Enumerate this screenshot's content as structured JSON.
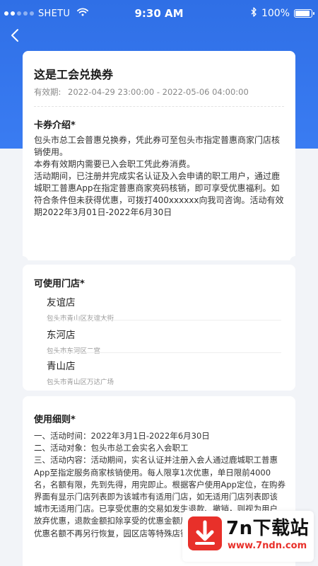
{
  "status_bar": {
    "carrier": "SHETU",
    "time": "9:30 AM",
    "battery": "100%",
    "battery_level": 1.0
  },
  "nav": {
    "back_icon": "chevron-left-icon"
  },
  "coupon": {
    "title": "这是工会兑换券",
    "validity_label": "有效期:",
    "validity_value": "2022-04-29 23:00:00 - 2022-05-06 04:00:00",
    "intro_title": "卡券介绍*",
    "intro_paragraphs": [
      "包头市总工会普惠兑换券，凭此券可至包头市指定普惠商家门店核销使用。",
      "本券有效期内需要已入会职工凭此券消费。",
      "活动期间，已注册并完成实名认证及入会申请的职工用户，通过鹿城职工普惠App在指定普惠商家亮码核销，即可享受优惠福利。如符合条件但未获得优惠，可拨打400xxxxxx向我司咨询。活动有效期2022年3月01日-2022年6月30日"
    ]
  },
  "stores": {
    "title": "可使用门店*",
    "items": [
      {
        "name": "友谊店",
        "address": "包头市青山区友谊大街"
      },
      {
        "name": "东河店",
        "address": "包头市东河区二宫"
      },
      {
        "name": "青山店",
        "address": "包头市青山区万达广场"
      }
    ]
  },
  "rules": {
    "title": "使用细则*",
    "lines": [
      "一、活动时间：2022年3月1日-2022年6月30日",
      "二、活动对象：包头市总工会实名入会职工",
      "三、活动内容：活动期间，实名认证并注册入会人通过鹿城职工普惠App至指定服务商家核销使用。每人限享1次优惠，单日限前4000名，名额有限，先到先得，用完即止。根据客户使用App定位，在购券界面有显示门店列表即为该城市有适用门店，如无适用门店列表即该城市无适用门店。已享受优惠的交易如发生退款、撤销，则视为用户放弃优惠，退款金额扣除享受的优惠金额后退回。如享受活动优惠，优惠名额不再另行恢复，园区店等特殊店铺不参与上述活动，具"
    ]
  },
  "watermark": {
    "brand": "7n下载站",
    "url": "www.7ndn.com",
    "icon": "download-arrow-icon",
    "color": "#e8302a"
  },
  "colors": {
    "primary_blue": "#2f6fe6",
    "background": "#f2f4f8"
  }
}
